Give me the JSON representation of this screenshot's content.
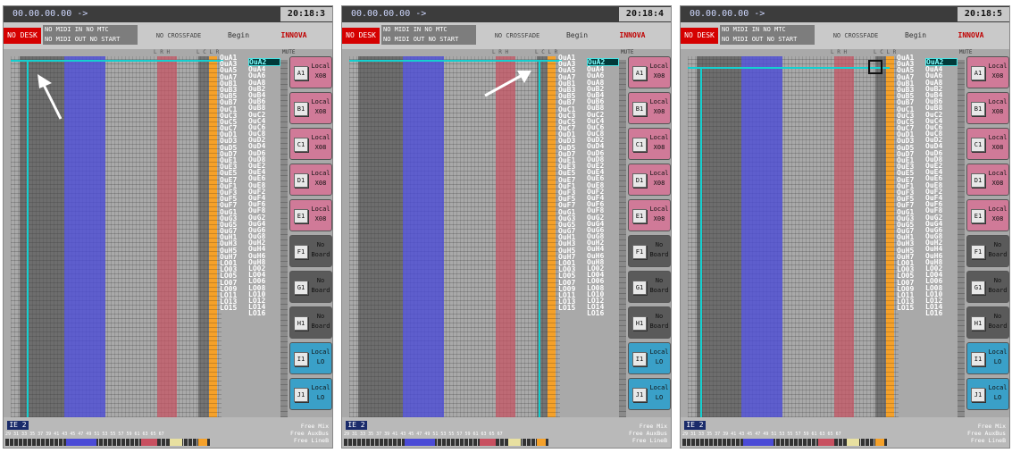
{
  "panels": [
    {
      "timecode": "00.00.00.00 ->",
      "clock": "20:18:3",
      "no_desk": "NO DESK",
      "midi_lines": [
        "NO MIDI IN  NO MTC",
        "NO MIDI OUT NO START"
      ],
      "crossfade": "NO CROSSFADE",
      "begin": "Begin",
      "brand": "INNOVA",
      "lrh": "L R H",
      "lclr": "L C L R",
      "mute": "MUTE",
      "labels_left": [
        "OuA1",
        "OuA3",
        "OuA5",
        "OuA7",
        "OuB1",
        "OuB3",
        "OuB5",
        "OuB7",
        "OuC1",
        "OuC3",
        "OuC5",
        "OuC7",
        "OuD1",
        "OuD3",
        "OuD5",
        "OuD7",
        "OuE1",
        "OuE3",
        "OuE5",
        "OuE7",
        "OuF1",
        "OuF3",
        "OuF5",
        "OuF7",
        "OuG1",
        "OuG3",
        "OuG5",
        "OuG7",
        "OuH1",
        "OuH3",
        "OuH5",
        "OuH7",
        "LO01",
        "LO03",
        "LO05",
        "LO07",
        "LO09",
        "LO11",
        "LO13",
        "LO15"
      ],
      "labels_right": [
        "OuA2",
        "OuA4",
        "OuA6",
        "OuA8",
        "OuB2",
        "OuB4",
        "OuB6",
        "OuB8",
        "OuC2",
        "OuC4",
        "OuC6",
        "OuC8",
        "OuD2",
        "OuD4",
        "OuD6",
        "OuD8",
        "OuE2",
        "OuE4",
        "OuE6",
        "OuE8",
        "OuF2",
        "OuF4",
        "OuF6",
        "OuF8",
        "OuG2",
        "OuG4",
        "OuG6",
        "OuG8",
        "OuH2",
        "OuH4",
        "OuH6",
        "OuH8",
        "LO02",
        "LO04",
        "LO06",
        "LO08",
        "LO10",
        "LO12",
        "LO14",
        "LO16"
      ],
      "outputs": [
        {
          "key": "A1",
          "l1": "Local",
          "l2": "X08",
          "color": "#d07a98"
        },
        {
          "key": "B1",
          "l1": "Local",
          "l2": "X08",
          "color": "#d07a98"
        },
        {
          "key": "C1",
          "l1": "Local",
          "l2": "X08",
          "color": "#d07a98"
        },
        {
          "key": "D1",
          "l1": "Local",
          "l2": "X08",
          "color": "#d07a98"
        },
        {
          "key": "E1",
          "l1": "Local",
          "l2": "X08",
          "color": "#d07a98"
        },
        {
          "key": "F1",
          "l1": "No",
          "l2": "Board",
          "color": "#5a5a5a"
        },
        {
          "key": "G1",
          "l1": "No",
          "l2": "Board",
          "color": "#5a5a5a"
        },
        {
          "key": "H1",
          "l1": "No",
          "l2": "Board",
          "color": "#5a5a5a"
        },
        {
          "key": "I1",
          "l1": "Local",
          "l2": "LO",
          "color": "#3aa0c8"
        },
        {
          "key": "J1",
          "l1": "Local",
          "l2": "LO",
          "color": "#3aa0c8"
        }
      ],
      "ie_label": "IE 2",
      "nums": "29 31 33 35 37 39 41 43 45 47 49 51 53 55 57 59 61 63 65 67",
      "free": [
        "Free Mix",
        "Free AuxBus",
        "Free LineB"
      ]
    },
    {
      "timecode": "00.00.00.00 ->",
      "clock": "20:18:4",
      "no_desk": "NO DESK",
      "midi_lines": [
        "NO MIDI IN  NO MTC",
        "NO MIDI OUT NO START"
      ],
      "crossfade": "NO CROSSFADE",
      "begin": "Begin",
      "brand": "INNOVA",
      "lrh": "L R H",
      "lclr": "L C L R",
      "mute": "MUTE",
      "labels_left": [
        "OuA1",
        "OuA3",
        "OuA5",
        "OuA7",
        "OuB1",
        "OuB3",
        "OuB5",
        "OuB7",
        "OuC1",
        "OuC3",
        "OuC5",
        "OuC7",
        "OuD1",
        "OuD3",
        "OuD5",
        "OuD7",
        "OuE1",
        "OuE3",
        "OuE5",
        "OuE7",
        "OuF1",
        "OuF3",
        "OuF5",
        "OuF7",
        "OuG1",
        "OuG3",
        "OuG5",
        "OuG7",
        "OuH1",
        "OuH3",
        "OuH5",
        "OuH7",
        "LO01",
        "LO03",
        "LO05",
        "LO07",
        "LO09",
        "LO11",
        "LO13",
        "LO15"
      ],
      "labels_right": [
        "OuA2",
        "OuA4",
        "OuA6",
        "OuA8",
        "OuB2",
        "OuB4",
        "OuB6",
        "OuB8",
        "OuC2",
        "OuC4",
        "OuC6",
        "OuC8",
        "OuD2",
        "OuD4",
        "OuD6",
        "OuD8",
        "OuE2",
        "OuE4",
        "OuE6",
        "OuE8",
        "OuF2",
        "OuF4",
        "OuF6",
        "OuF8",
        "OuG2",
        "OuG4",
        "OuG6",
        "OuG8",
        "OuH2",
        "OuH4",
        "OuH6",
        "OuH8",
        "LO02",
        "LO04",
        "LO06",
        "LO08",
        "LO10",
        "LO12",
        "LO14",
        "LO16"
      ],
      "outputs": [
        {
          "key": "A1",
          "l1": "Local",
          "l2": "X08",
          "color": "#d07a98"
        },
        {
          "key": "B1",
          "l1": "Local",
          "l2": "X08",
          "color": "#d07a98"
        },
        {
          "key": "C1",
          "l1": "Local",
          "l2": "X08",
          "color": "#d07a98"
        },
        {
          "key": "D1",
          "l1": "Local",
          "l2": "X08",
          "color": "#d07a98"
        },
        {
          "key": "E1",
          "l1": "Local",
          "l2": "X08",
          "color": "#d07a98"
        },
        {
          "key": "F1",
          "l1": "No",
          "l2": "Board",
          "color": "#5a5a5a"
        },
        {
          "key": "G1",
          "l1": "No",
          "l2": "Board",
          "color": "#5a5a5a"
        },
        {
          "key": "H1",
          "l1": "No",
          "l2": "Board",
          "color": "#5a5a5a"
        },
        {
          "key": "I1",
          "l1": "Local",
          "l2": "LO",
          "color": "#3aa0c8"
        },
        {
          "key": "J1",
          "l1": "Local",
          "l2": "LO",
          "color": "#3aa0c8"
        }
      ],
      "ie_label": "IE 2",
      "nums": "29 31 33 35 37 39 41 43 45 47 49 51 53 55 57 59 61 63 65 67",
      "free": [
        "Free Mix",
        "Free AuxBus",
        "Free LineB"
      ]
    },
    {
      "timecode": "00.00.00.00 ->",
      "clock": "20:18:5",
      "no_desk": "NO DESK",
      "midi_lines": [
        "NO MIDI IN  NO MTC",
        "NO MIDI OUT NO START"
      ],
      "crossfade": "NO CROSSFADE",
      "begin": "Begin",
      "brand": "INNOVA",
      "lrh": "L R H",
      "lclr": "L C L R",
      "mute": "MUTE",
      "labels_left": [
        "OuA1",
        "OuA3",
        "OuA5",
        "OuA7",
        "OuB1",
        "OuB3",
        "OuB5",
        "OuB7",
        "OuC1",
        "OuC3",
        "OuC5",
        "OuC7",
        "OuD1",
        "OuD3",
        "OuD5",
        "OuD7",
        "OuE1",
        "OuE3",
        "OuE5",
        "OuE7",
        "OuF1",
        "OuF3",
        "OuF5",
        "OuF7",
        "OuG1",
        "OuG3",
        "OuG5",
        "OuG7",
        "OuH1",
        "OuH3",
        "OuH5",
        "OuH7",
        "LO01",
        "LO03",
        "LO05",
        "LO07",
        "LO09",
        "LO11",
        "LO13",
        "LO15"
      ],
      "labels_right": [
        "OuA2",
        "OuA4",
        "OuA6",
        "OuA8",
        "OuB2",
        "OuB4",
        "OuB6",
        "OuB8",
        "OuC2",
        "OuC4",
        "OuC6",
        "OuC8",
        "OuD2",
        "OuD4",
        "OuD6",
        "OuD8",
        "OuE2",
        "OuE4",
        "OuE6",
        "OuE8",
        "OuF2",
        "OuF4",
        "OuF6",
        "OuF8",
        "OuG2",
        "OuG4",
        "OuG6",
        "OuG8",
        "OuH2",
        "OuH4",
        "OuH6",
        "OuH8",
        "LO02",
        "LO04",
        "LO06",
        "LO08",
        "LO10",
        "LO12",
        "LO14",
        "LO16"
      ],
      "outputs": [
        {
          "key": "A1",
          "l1": "Local",
          "l2": "X08",
          "color": "#d07a98"
        },
        {
          "key": "B1",
          "l1": "Local",
          "l2": "X08",
          "color": "#d07a98"
        },
        {
          "key": "C1",
          "l1": "Local",
          "l2": "X08",
          "color": "#d07a98"
        },
        {
          "key": "D1",
          "l1": "Local",
          "l2": "X08",
          "color": "#d07a98"
        },
        {
          "key": "E1",
          "l1": "Local",
          "l2": "X08",
          "color": "#d07a98"
        },
        {
          "key": "F1",
          "l1": "No",
          "l2": "Board",
          "color": "#5a5a5a"
        },
        {
          "key": "G1",
          "l1": "No",
          "l2": "Board",
          "color": "#5a5a5a"
        },
        {
          "key": "H1",
          "l1": "No",
          "l2": "Board",
          "color": "#5a5a5a"
        },
        {
          "key": "I1",
          "l1": "Local",
          "l2": "LO",
          "color": "#3aa0c8"
        },
        {
          "key": "J1",
          "l1": "Local",
          "l2": "LO",
          "color": "#3aa0c8"
        }
      ],
      "ie_label": "IE 2",
      "nums": "29 31 33 35 37 39 41 43 45 47 49 51 53 55 57 59 61 63 65 67",
      "free": [
        "Free Mix",
        "Free AuxBus",
        "Free LineB"
      ]
    }
  ],
  "colors": {
    "grid_gray": "#9a9a9a",
    "dark_block": "#3d3d3d",
    "blue_block": "#4b4bd6",
    "red_block": "#c85060",
    "orange_col": "#f5a12a",
    "teal_line": "#14d0d0",
    "selected_label_bg": "#003a3a"
  },
  "icons": {
    "arrow": "white-arrow-icon",
    "cursor": "selection-cursor-icon"
  }
}
